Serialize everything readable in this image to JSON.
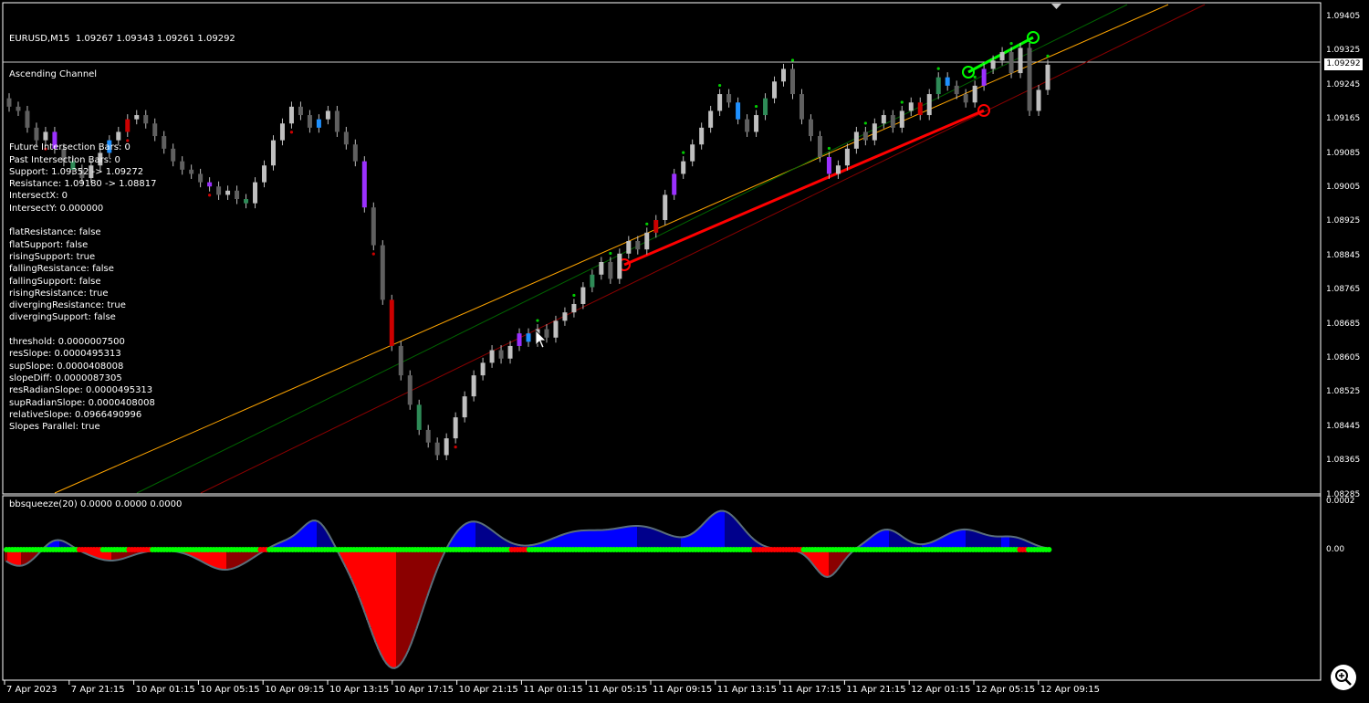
{
  "header": {
    "symbol_line": "EURUSD,M15  1.09267 1.09343 1.09261 1.09292",
    "indicator_name": "Ascending Channel"
  },
  "info_lines": [
    "Future Intersection Bars: 0",
    "Past Intersection Bars: 0",
    "Support: 1.09352 -> 1.09272",
    "Resistance: 1.09180 -> 1.08817",
    "IntersectX: 0",
    "IntersectY: 0.000000",
    "",
    "flatResistance: false",
    "flatSupport: false",
    "risingSupport: true",
    "fallingResistance: false",
    "fallingSupport: false",
    "risingResistance: true",
    "divergingResistance: true",
    "divergingSupport: false",
    "",
    "threshold: 0.0000007500",
    "resSlope: 0.0000495313",
    "supSlope: 0.0000408008",
    "slopeDiff: 0.0000087305",
    "resRadianSlope: 0.0000495313",
    "supRadianSlope: 0.0000408008",
    "relativeSlope: 0.0966490996",
    "Slopes Parallel: true"
  ],
  "price_axis": [
    "1.09405",
    "1.09325",
    "1.09245",
    "1.09165",
    "1.09085",
    "1.09005",
    "1.08925",
    "1.08845",
    "1.08765",
    "1.08685",
    "1.08605",
    "1.08525",
    "1.08445",
    "1.08365",
    "1.08285"
  ],
  "current_price": "1.09292",
  "indicator": {
    "label": "bbsqueeze(20) 0.0000 0.0000 0.0000",
    "axis": [
      "0.0002",
      "0.00"
    ]
  },
  "time_axis": [
    "7 Apr 2023",
    "7 Apr 21:15",
    "10 Apr 01:15",
    "10 Apr 05:15",
    "10 Apr 09:15",
    "10 Apr 13:15",
    "10 Apr 17:15",
    "10 Apr 21:15",
    "11 Apr 01:15",
    "11 Apr 05:15",
    "11 Apr 09:15",
    "11 Apr 13:15",
    "11 Apr 17:15",
    "11 Apr 21:15",
    "12 Apr 01:15",
    "12 Apr 05:15",
    "12 Apr 09:15"
  ],
  "colors": {
    "bull": "#c0c0c0",
    "bear": "#606060",
    "resistance": "#ff0000",
    "support": "#00ff00",
    "channel": "#ffa500",
    "squeeze_pos": "#0000ff",
    "squeeze_neg": "#ff0000",
    "dots": "#00ff00"
  },
  "chart_data": {
    "type": "candlestick",
    "closes": [
      1.0919,
      1.0918,
      1.0914,
      1.0911,
      1.0913,
      1.0909,
      1.0906,
      1.0904,
      1.0902,
      1.0905,
      1.0908,
      1.0911,
      1.0913,
      1.0916,
      1.0917,
      1.0915,
      1.0912,
      1.0909,
      1.0906,
      1.0904,
      1.0903,
      1.0901,
      1.09,
      1.0898,
      1.0899,
      1.0897,
      1.0896,
      1.0901,
      1.0905,
      1.0911,
      1.0915,
      1.0919,
      1.0917,
      1.0914,
      1.0916,
      1.0918,
      1.0913,
      1.091,
      1.0906,
      1.0895,
      1.0886,
      1.0873,
      1.0862,
      1.0855,
      1.0848,
      1.0842,
      1.0839,
      1.0836,
      1.084,
      1.0845,
      1.085,
      1.0855,
      1.0858,
      1.0861,
      1.0859,
      1.0862,
      1.0865,
      1.0863,
      1.0866,
      1.0864,
      1.0868,
      1.087,
      1.0872,
      1.0876,
      1.0879,
      1.0882,
      1.0878,
      1.0884,
      1.0887,
      1.0885,
      1.0889,
      1.0892,
      1.0898,
      1.0903,
      1.0906,
      1.091,
      1.0914,
      1.0918,
      1.0922,
      1.092,
      1.0916,
      1.0913,
      1.0917,
      1.0921,
      1.0925,
      1.0928,
      1.0922,
      1.0916,
      1.0912,
      1.0907,
      1.0903,
      1.0905,
      1.0909,
      1.0913,
      1.0911,
      1.0915,
      1.0917,
      1.0914,
      1.0918,
      1.092,
      1.0917,
      1.0922,
      1.0926,
      1.0924,
      1.0922,
      1.092,
      1.0924,
      1.0928,
      1.093,
      1.0932,
      1.0927,
      1.0933,
      1.0918,
      1.0923,
      1.0929
    ]
  }
}
